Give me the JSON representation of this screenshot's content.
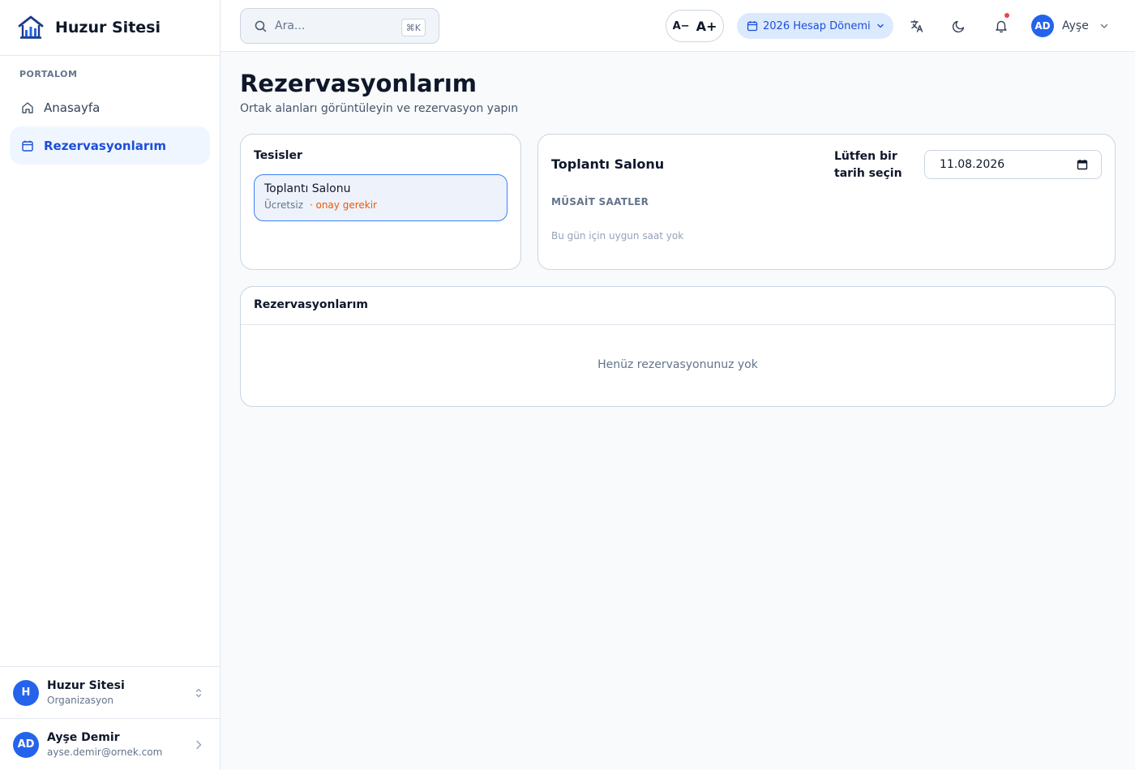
{
  "brand": {
    "name": "Huzur Sitesi"
  },
  "sidebar": {
    "section_label": "PORTALOM",
    "items": [
      {
        "label": "Anasayfa",
        "icon": "home-icon",
        "active": false
      },
      {
        "label": "Rezervasyonlarım",
        "icon": "calendar-icon",
        "active": true
      }
    ],
    "org": {
      "initial": "H",
      "name": "Huzur Sitesi",
      "type": "Organizasyon"
    },
    "user": {
      "initials": "AD",
      "name": "Ayşe Demir",
      "email": "ayse.demir@ornek.com"
    }
  },
  "topbar": {
    "search": {
      "placeholder": "Ara...",
      "shortcut": "⌘K"
    },
    "font_decrease": "A−",
    "font_increase": "A+",
    "period_label": "2026 Hesap Dönemi",
    "user": {
      "initials": "AD",
      "name": "Ayşe"
    }
  },
  "page": {
    "title": "Rezervasyonlarım",
    "subtitle": "Ortak alanları görüntüleyin ve rezervasyon yapın"
  },
  "facilities": {
    "heading": "Tesisler",
    "items": [
      {
        "name": "Toplantı Salonu",
        "price": "Ücretsiz",
        "approval": "· onay gerekir"
      }
    ]
  },
  "slots": {
    "facility_title": "Toplantı Salonu",
    "date_label": "Lütfen bir tarih seçin",
    "date_value": "11.08.2026",
    "available_label": "MÜSAİT SAATLER",
    "empty_text": "Bu gün için uygun saat yok"
  },
  "reservations": {
    "heading": "Rezervasyonlarım",
    "empty_text": "Henüz rezervasyonunuz yok"
  },
  "colors": {
    "accent": "#2563eb",
    "accent_dark": "#1d4ed8",
    "active_bg": "#eff6ff",
    "warning": "#ea580c",
    "notification": "#ef4444"
  }
}
